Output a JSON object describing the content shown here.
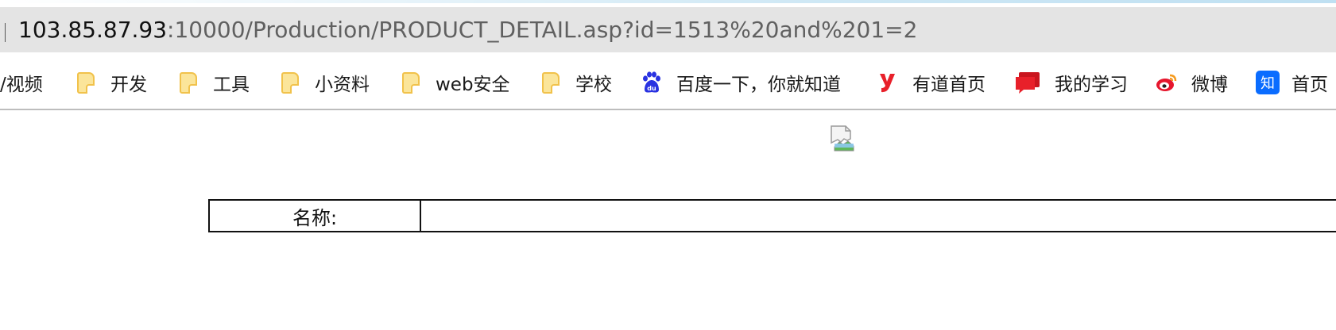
{
  "address_bar": {
    "url_host": "103.85.87.93",
    "url_rest": ":10000/Production/PRODUCT_DETAIL.asp?id=1513%20and%201=2"
  },
  "bookmarks": [
    {
      "label": "/视频",
      "icon": "none"
    },
    {
      "label": "开发",
      "icon": "folder-icon"
    },
    {
      "label": "工具",
      "icon": "folder-icon"
    },
    {
      "label": "小资料",
      "icon": "folder-icon"
    },
    {
      "label": "web安全",
      "icon": "folder-icon"
    },
    {
      "label": "学校",
      "icon": "folder-icon"
    },
    {
      "label": "百度一下，你就知道",
      "icon": "baidu-paw-icon"
    },
    {
      "label": "有道首页",
      "icon": "youdao-icon"
    },
    {
      "label": "我的学习",
      "icon": "chat-bubble-icon"
    },
    {
      "label": "微博",
      "icon": "weibo-icon"
    },
    {
      "label": "首页",
      "icon": "zhihu-icon"
    }
  ],
  "page": {
    "image_alt": "",
    "table": {
      "rows": [
        {
          "label": "名称:",
          "value": ""
        }
      ]
    }
  },
  "colors": {
    "address_bar_bg": "#e4e4e4",
    "folder_fill": "#fbe59a",
    "folder_stroke": "#f1c24b",
    "baidu_blue": "#2932e1",
    "youdao_red": "#e8202a",
    "zhihu_blue": "#0a6cff",
    "weibo_red": "#e6162d"
  }
}
